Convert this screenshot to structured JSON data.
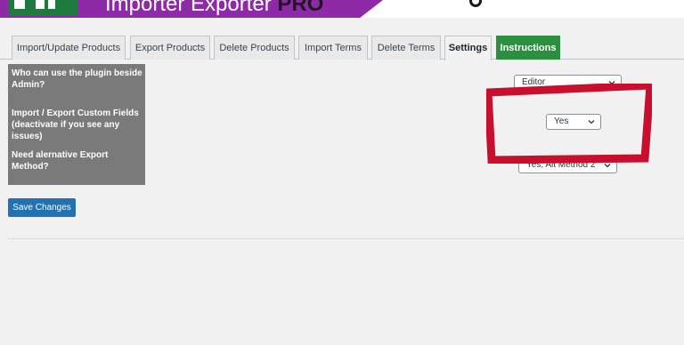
{
  "banner": {
    "title": "Importer Exporter",
    "title_suffix": "PRO",
    "logo_icon": "spreadsheet-logo-icon",
    "brand_purple": "#8e2aa8",
    "brand_green": "#1e7a3e"
  },
  "tabs": [
    {
      "label": "Import/Update Products",
      "active": false
    },
    {
      "label": "Export Products",
      "active": false
    },
    {
      "label": "Delete Products",
      "active": false
    },
    {
      "label": "Import Terms",
      "active": false
    },
    {
      "label": "Delete Terms",
      "active": false
    },
    {
      "label": "Settings",
      "active": true
    },
    {
      "label": "Instructions",
      "active": false
    }
  ],
  "settings": {
    "rows": [
      {
        "label": "Who can use the plugin beside Admin?",
        "value": "Editor"
      },
      {
        "label": "Import / Export Custom Fields (deactivate if you see any issues)",
        "value": "Yes"
      },
      {
        "label": "Need alernative Export Method?",
        "value": "Yes, Alt Method 2"
      }
    ],
    "chevron_icon": "chevron-down-icon"
  },
  "save_label": "Save Changes",
  "colors": {
    "accent": "#2271b1",
    "instructions_tab": "#2b8f3f",
    "highlight": "#c8102e",
    "label_panel": "#7a7a7a"
  }
}
